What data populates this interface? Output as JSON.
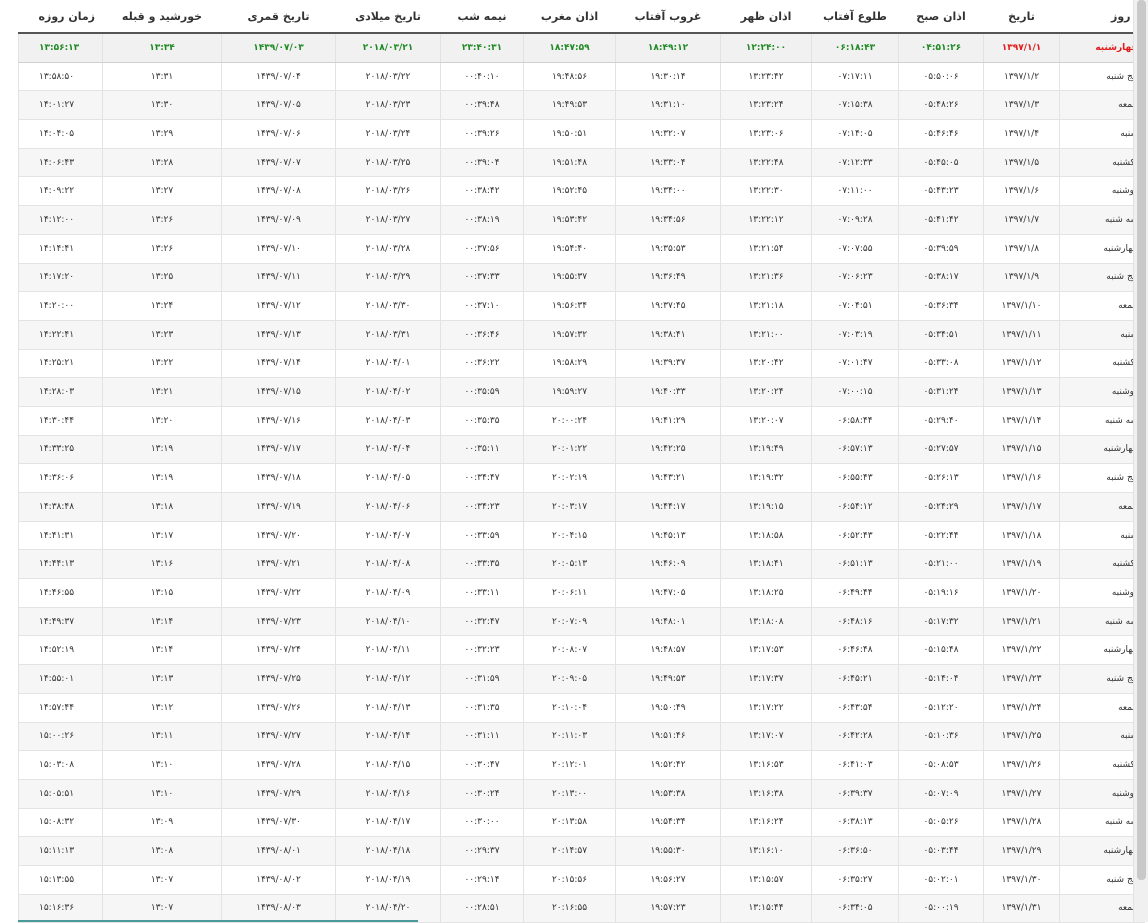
{
  "headers": [
    "روز",
    "تاریخ",
    "اذان صبح",
    "طلوع آفتاب",
    "اذان ظهر",
    "غروب آفتاب",
    "اذان مغرب",
    "نیمه شب",
    "تاریخ میلادی",
    "تاریخ قمری",
    "خورشید و قبله",
    "زمان روزه"
  ],
  "rows": [
    [
      "چهارشنبه",
      "۱۳۹۷/۱/۱",
      "۰۴:۵۱:۲۶",
      "۰۶:۱۸:۴۳",
      "۱۲:۲۴:۰۰",
      "۱۸:۴۹:۱۲",
      "۱۸:۴۷:۵۹",
      "۲۳:۴۰:۳۱",
      "۲۰۱۸/۰۳/۲۱",
      "۱۴۳۹/۰۷/۰۳",
      "۱۳:۳۴",
      "۱۳:۵۶:۱۳"
    ],
    [
      "پنج شنبه",
      "۱۳۹۷/۱/۲",
      "۰۵:۵۰:۰۶",
      "۰۷:۱۷:۱۱",
      "۱۳:۲۳:۴۲",
      "۱۹:۳۰:۱۴",
      "۱۹:۴۸:۵۶",
      "۰۰:۴۰:۱۰",
      "۲۰۱۸/۰۳/۲۲",
      "۱۴۳۹/۰۷/۰۴",
      "۱۳:۳۱",
      "۱۳:۵۸:۵۰"
    ],
    [
      "جمعه",
      "۱۳۹۷/۱/۳",
      "۰۵:۴۸:۲۶",
      "۰۷:۱۵:۳۸",
      "۱۳:۲۳:۲۴",
      "۱۹:۳۱:۱۰",
      "۱۹:۴۹:۵۳",
      "۰۰:۳۹:۴۸",
      "۲۰۱۸/۰۳/۲۳",
      "۱۴۳۹/۰۷/۰۵",
      "۱۳:۳۰",
      "۱۴:۰۱:۲۷"
    ],
    [
      "شنبه",
      "۱۳۹۷/۱/۴",
      "۰۵:۴۶:۴۶",
      "۰۷:۱۴:۰۵",
      "۱۳:۲۳:۰۶",
      "۱۹:۳۲:۰۷",
      "۱۹:۵۰:۵۱",
      "۰۰:۳۹:۲۶",
      "۲۰۱۸/۰۳/۲۴",
      "۱۴۳۹/۰۷/۰۶",
      "۱۳:۲۹",
      "۱۴:۰۴:۰۵"
    ],
    [
      "یکشنبه",
      "۱۳۹۷/۱/۵",
      "۰۵:۴۵:۰۵",
      "۰۷:۱۲:۳۳",
      "۱۳:۲۲:۴۸",
      "۱۹:۳۳:۰۴",
      "۱۹:۵۱:۴۸",
      "۰۰:۳۹:۰۴",
      "۲۰۱۸/۰۳/۲۵",
      "۱۴۳۹/۰۷/۰۷",
      "۱۳:۲۸",
      "۱۴:۰۶:۴۳"
    ],
    [
      "دوشنبه",
      "۱۳۹۷/۱/۶",
      "۰۵:۴۳:۲۳",
      "۰۷:۱۱:۰۰",
      "۱۳:۲۲:۳۰",
      "۱۹:۳۴:۰۰",
      "۱۹:۵۲:۴۵",
      "۰۰:۳۸:۴۲",
      "۲۰۱۸/۰۳/۲۶",
      "۱۴۳۹/۰۷/۰۸",
      "۱۳:۲۷",
      "۱۴:۰۹:۲۲"
    ],
    [
      "سه شنبه",
      "۱۳۹۷/۱/۷",
      "۰۵:۴۱:۴۲",
      "۰۷:۰۹:۲۸",
      "۱۳:۲۲:۱۲",
      "۱۹:۳۴:۵۶",
      "۱۹:۵۳:۴۲",
      "۰۰:۳۸:۱۹",
      "۲۰۱۸/۰۳/۲۷",
      "۱۴۳۹/۰۷/۰۹",
      "۱۳:۲۶",
      "۱۴:۱۲:۰۰"
    ],
    [
      "چهارشنبه",
      "۱۳۹۷/۱/۸",
      "۰۵:۳۹:۵۹",
      "۰۷:۰۷:۵۵",
      "۱۳:۲۱:۵۴",
      "۱۹:۳۵:۵۳",
      "۱۹:۵۴:۴۰",
      "۰۰:۳۷:۵۶",
      "۲۰۱۸/۰۳/۲۸",
      "۱۴۳۹/۰۷/۱۰",
      "۱۳:۲۶",
      "۱۴:۱۴:۴۱"
    ],
    [
      "پنج شنبه",
      "۱۳۹۷/۱/۹",
      "۰۵:۳۸:۱۷",
      "۰۷:۰۶:۲۳",
      "۱۳:۲۱:۳۶",
      "۱۹:۳۶:۴۹",
      "۱۹:۵۵:۳۷",
      "۰۰:۳۷:۳۳",
      "۲۰۱۸/۰۳/۲۹",
      "۱۴۳۹/۰۷/۱۱",
      "۱۳:۲۵",
      "۱۴:۱۷:۲۰"
    ],
    [
      "جمعه",
      "۱۳۹۷/۱/۱۰",
      "۰۵:۳۶:۳۴",
      "۰۷:۰۴:۵۱",
      "۱۳:۲۱:۱۸",
      "۱۹:۳۷:۴۵",
      "۱۹:۵۶:۳۴",
      "۰۰:۳۷:۱۰",
      "۲۰۱۸/۰۳/۳۰",
      "۱۴۳۹/۰۷/۱۲",
      "۱۳:۲۴",
      "۱۴:۲۰:۰۰"
    ],
    [
      "شنبه",
      "۱۳۹۷/۱/۱۱",
      "۰۵:۳۴:۵۱",
      "۰۷:۰۳:۱۹",
      "۱۳:۲۱:۰۰",
      "۱۹:۳۸:۴۱",
      "۱۹:۵۷:۳۲",
      "۰۰:۳۶:۴۶",
      "۲۰۱۸/۰۳/۳۱",
      "۱۴۳۹/۰۷/۱۳",
      "۱۳:۲۳",
      "۱۴:۲۲:۴۱"
    ],
    [
      "یکشنبه",
      "۱۳۹۷/۱/۱۲",
      "۰۵:۳۳:۰۸",
      "۰۷:۰۱:۴۷",
      "۱۳:۲۰:۴۲",
      "۱۹:۳۹:۳۷",
      "۱۹:۵۸:۲۹",
      "۰۰:۳۶:۲۲",
      "۲۰۱۸/۰۴/۰۱",
      "۱۴۳۹/۰۷/۱۴",
      "۱۳:۲۲",
      "۱۴:۲۵:۲۱"
    ],
    [
      "دوشنبه",
      "۱۳۹۷/۱/۱۳",
      "۰۵:۳۱:۲۴",
      "۰۷:۰۰:۱۵",
      "۱۳:۲۰:۲۴",
      "۱۹:۴۰:۳۳",
      "۱۹:۵۹:۲۷",
      "۰۰:۳۵:۵۹",
      "۲۰۱۸/۰۴/۰۲",
      "۱۴۳۹/۰۷/۱۵",
      "۱۳:۲۱",
      "۱۴:۲۸:۰۳"
    ],
    [
      "سه شنبه",
      "۱۳۹۷/۱/۱۴",
      "۰۵:۲۹:۴۰",
      "۰۶:۵۸:۴۴",
      "۱۳:۲۰:۰۷",
      "۱۹:۴۱:۲۹",
      "۲۰:۰۰:۲۴",
      "۰۰:۳۵:۳۵",
      "۲۰۱۸/۰۴/۰۳",
      "۱۴۳۹/۰۷/۱۶",
      "۱۳:۲۰",
      "۱۴:۳۰:۴۴"
    ],
    [
      "چهارشنبه",
      "۱۳۹۷/۱/۱۵",
      "۰۵:۲۷:۵۷",
      "۰۶:۵۷:۱۳",
      "۱۳:۱۹:۴۹",
      "۱۹:۴۲:۲۵",
      "۲۰:۰۱:۲۲",
      "۰۰:۳۵:۱۱",
      "۲۰۱۸/۰۴/۰۴",
      "۱۴۳۹/۰۷/۱۷",
      "۱۳:۱۹",
      "۱۴:۳۳:۲۵"
    ],
    [
      "پنج شنبه",
      "۱۳۹۷/۱/۱۶",
      "۰۵:۲۶:۱۳",
      "۰۶:۵۵:۴۳",
      "۱۳:۱۹:۳۲",
      "۱۹:۴۳:۲۱",
      "۲۰:۰۲:۱۹",
      "۰۰:۳۴:۴۷",
      "۲۰۱۸/۰۴/۰۵",
      "۱۴۳۹/۰۷/۱۸",
      "۱۳:۱۹",
      "۱۴:۳۶:۰۶"
    ],
    [
      "جمعه",
      "۱۳۹۷/۱/۱۷",
      "۰۵:۲۴:۲۹",
      "۰۶:۵۴:۱۲",
      "۱۳:۱۹:۱۵",
      "۱۹:۴۴:۱۷",
      "۲۰:۰۳:۱۷",
      "۰۰:۳۴:۲۳",
      "۲۰۱۸/۰۴/۰۶",
      "۱۴۳۹/۰۷/۱۹",
      "۱۳:۱۸",
      "۱۴:۳۸:۴۸"
    ],
    [
      "شنبه",
      "۱۳۹۷/۱/۱۸",
      "۰۵:۲۲:۴۴",
      "۰۶:۵۲:۴۳",
      "۱۳:۱۸:۵۸",
      "۱۹:۴۵:۱۳",
      "۲۰:۰۴:۱۵",
      "۰۰:۳۳:۵۹",
      "۲۰۱۸/۰۴/۰۷",
      "۱۴۳۹/۰۷/۲۰",
      "۱۳:۱۷",
      "۱۴:۴۱:۳۱"
    ],
    [
      "یکشنبه",
      "۱۳۹۷/۱/۱۹",
      "۰۵:۲۱:۰۰",
      "۰۶:۵۱:۱۳",
      "۱۳:۱۸:۴۱",
      "۱۹:۴۶:۰۹",
      "۲۰:۰۵:۱۳",
      "۰۰:۳۳:۳۵",
      "۲۰۱۸/۰۴/۰۸",
      "۱۴۳۹/۰۷/۲۱",
      "۱۳:۱۶",
      "۱۴:۴۴:۱۳"
    ],
    [
      "دوشنبه",
      "۱۳۹۷/۱/۲۰",
      "۰۵:۱۹:۱۶",
      "۰۶:۴۹:۴۴",
      "۱۳:۱۸:۲۵",
      "۱۹:۴۷:۰۵",
      "۲۰:۰۶:۱۱",
      "۰۰:۳۳:۱۱",
      "۲۰۱۸/۰۴/۰۹",
      "۱۴۳۹/۰۷/۲۲",
      "۱۳:۱۵",
      "۱۴:۴۶:۵۵"
    ],
    [
      "سه شنبه",
      "۱۳۹۷/۱/۲۱",
      "۰۵:۱۷:۳۲",
      "۰۶:۴۸:۱۶",
      "۱۳:۱۸:۰۸",
      "۱۹:۴۸:۰۱",
      "۲۰:۰۷:۰۹",
      "۰۰:۳۲:۴۷",
      "۲۰۱۸/۰۴/۱۰",
      "۱۴۳۹/۰۷/۲۳",
      "۱۳:۱۴",
      "۱۴:۴۹:۳۷"
    ],
    [
      "چهارشنبه",
      "۱۳۹۷/۱/۲۲",
      "۰۵:۱۵:۴۸",
      "۰۶:۴۶:۴۸",
      "۱۳:۱۷:۵۳",
      "۱۹:۴۸:۵۷",
      "۲۰:۰۸:۰۷",
      "۰۰:۳۲:۲۳",
      "۲۰۱۸/۰۴/۱۱",
      "۱۴۳۹/۰۷/۲۴",
      "۱۳:۱۴",
      "۱۴:۵۲:۱۹"
    ],
    [
      "پنج شنبه",
      "۱۳۹۷/۱/۲۳",
      "۰۵:۱۴:۰۴",
      "۰۶:۴۵:۲۱",
      "۱۳:۱۷:۳۷",
      "۱۹:۴۹:۵۳",
      "۲۰:۰۹:۰۵",
      "۰۰:۳۱:۵۹",
      "۲۰۱۸/۰۴/۱۲",
      "۱۴۳۹/۰۷/۲۵",
      "۱۳:۱۳",
      "۱۴:۵۵:۰۱"
    ],
    [
      "جمعه",
      "۱۳۹۷/۱/۲۴",
      "۰۵:۱۲:۲۰",
      "۰۶:۴۳:۵۴",
      "۱۳:۱۷:۲۲",
      "۱۹:۵۰:۴۹",
      "۲۰:۱۰:۰۴",
      "۰۰:۳۱:۳۵",
      "۲۰۱۸/۰۴/۱۳",
      "۱۴۳۹/۰۷/۲۶",
      "۱۳:۱۲",
      "۱۴:۵۷:۴۴"
    ],
    [
      "شنبه",
      "۱۳۹۷/۱/۲۵",
      "۰۵:۱۰:۳۶",
      "۰۶:۴۲:۲۸",
      "۱۳:۱۷:۰۷",
      "۱۹:۵۱:۴۶",
      "۲۰:۱۱:۰۳",
      "۰۰:۳۱:۱۱",
      "۲۰۱۸/۰۴/۱۴",
      "۱۴۳۹/۰۷/۲۷",
      "۱۳:۱۱",
      "۱۵:۰۰:۲۶"
    ],
    [
      "یکشنبه",
      "۱۳۹۷/۱/۲۶",
      "۰۵:۰۸:۵۳",
      "۰۶:۴۱:۰۳",
      "۱۳:۱۶:۵۳",
      "۱۹:۵۲:۴۲",
      "۲۰:۱۲:۰۱",
      "۰۰:۳۰:۴۷",
      "۲۰۱۸/۰۴/۱۵",
      "۱۴۳۹/۰۷/۲۸",
      "۱۳:۱۰",
      "۱۵:۰۳:۰۸"
    ],
    [
      "دوشنبه",
      "۱۳۹۷/۱/۲۷",
      "۰۵:۰۷:۰۹",
      "۰۶:۳۹:۳۷",
      "۱۳:۱۶:۳۸",
      "۱۹:۵۳:۳۸",
      "۲۰:۱۳:۰۰",
      "۰۰:۳۰:۲۴",
      "۲۰۱۸/۰۴/۱۶",
      "۱۴۳۹/۰۷/۲۹",
      "۱۳:۱۰",
      "۱۵:۰۵:۵۱"
    ],
    [
      "سه شنبه",
      "۱۳۹۷/۱/۲۸",
      "۰۵:۰۵:۲۶",
      "۰۶:۳۸:۱۳",
      "۱۳:۱۶:۲۴",
      "۱۹:۵۴:۳۴",
      "۲۰:۱۳:۵۸",
      "۰۰:۳۰:۰۰",
      "۲۰۱۸/۰۴/۱۷",
      "۱۴۳۹/۰۷/۳۰",
      "۱۳:۰۹",
      "۱۵:۰۸:۳۲"
    ],
    [
      "چهارشنبه",
      "۱۳۹۷/۱/۲۹",
      "۰۵:۰۳:۴۴",
      "۰۶:۳۶:۵۰",
      "۱۳:۱۶:۱۰",
      "۱۹:۵۵:۳۰",
      "۲۰:۱۴:۵۷",
      "۰۰:۲۹:۳۷",
      "۲۰۱۸/۰۴/۱۸",
      "۱۴۳۹/۰۸/۰۱",
      "۱۳:۰۸",
      "۱۵:۱۱:۱۳"
    ],
    [
      "پنج شنبه",
      "۱۳۹۷/۱/۳۰",
      "۰۵:۰۲:۰۱",
      "۰۶:۳۵:۲۷",
      "۱۳:۱۵:۵۷",
      "۱۹:۵۶:۲۷",
      "۲۰:۱۵:۵۶",
      "۰۰:۲۹:۱۴",
      "۲۰۱۸/۰۴/۱۹",
      "۱۴۳۹/۰۸/۰۲",
      "۱۳:۰۷",
      "۱۵:۱۳:۵۵"
    ],
    [
      "جمعه",
      "۱۳۹۷/۱/۳۱",
      "۰۵:۰۰:۱۹",
      "۰۶:۳۴:۰۵",
      "۱۳:۱۵:۴۴",
      "۱۹:۵۷:۲۳",
      "۲۰:۱۶:۵۵",
      "۰۰:۲۸:۵۱",
      "۲۰۱۸/۰۴/۲۰",
      "۱۴۳۹/۰۸/۰۳",
      "۱۳:۰۷",
      "۱۵:۱۶:۳۶"
    ]
  ],
  "colors": {
    "today_day": "#e01b1b",
    "today_values": "#1f8a24",
    "header_border": "#555555"
  }
}
